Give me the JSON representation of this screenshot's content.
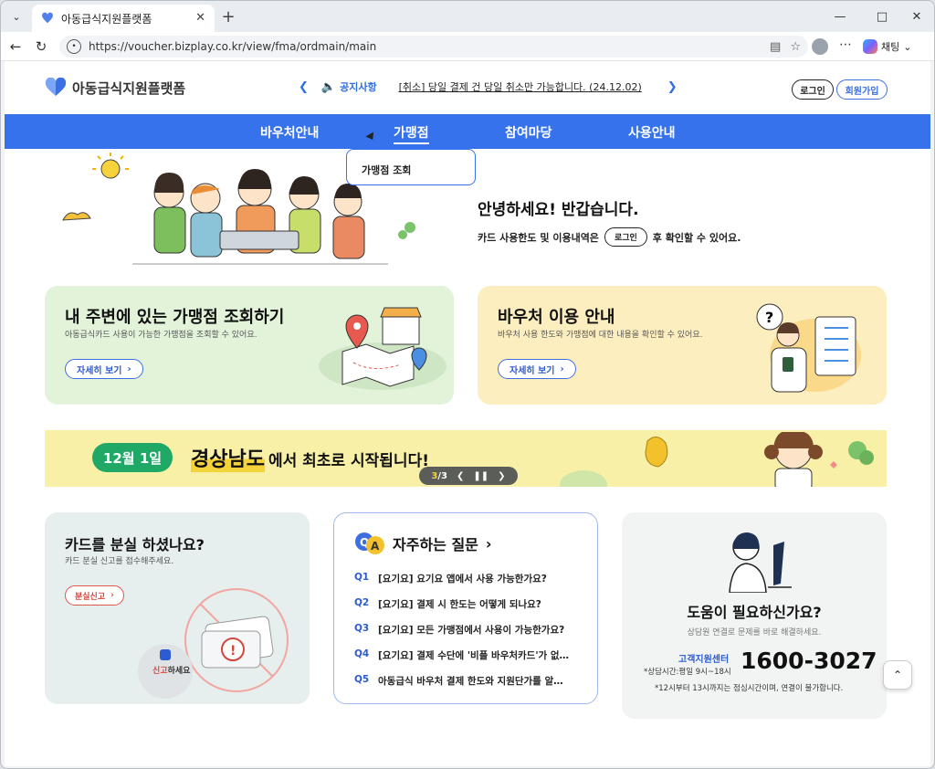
{
  "browser": {
    "tab_title": "아동급식지원플랫폼",
    "url": "https://voucher.bizplay.co.kr/view/fma/ordmain/main",
    "chat_label": "채팅"
  },
  "site": {
    "logo_text": "아동급식지원플랫폼",
    "notice_label": "공지사항",
    "notice_message": "[취소] 당일 결제 건 당일 취소만 가능합니다. (24.12.02)",
    "login_label": "로그인",
    "join_label": "회원가입"
  },
  "gnb": {
    "items": [
      "바우처안내",
      "가맹점",
      "참여마당",
      "사용안내"
    ],
    "active_index": 1,
    "dropdown_item": "가맹점 조회"
  },
  "hero": {
    "greeting": "안녕하세요! 반갑습니다.",
    "sub_before": "카드 사용한도 및 이용내역은",
    "sub_login": "로그인",
    "sub_after": "후 확인할 수 있어요."
  },
  "cards": {
    "nearby": {
      "title": "내 주변에 있는 가맹점 조회하기",
      "desc": "아동급식카드 사용이 가능한 가맹점을 조회할 수 있어요.",
      "button": "자세히 보기"
    },
    "voucher": {
      "title": "바우처 이용 안내",
      "desc": "바우처 사용 한도와 가맹점에 대한 내용을 확인할 수 있어요.",
      "button": "자세히 보기"
    },
    "lost": {
      "title": "카드를 분실 하셨나요?",
      "desc": "카드 분실 신고를 접수해주세요.",
      "button": "분실신고",
      "badge_red": "신고",
      "badge_rest": "하세요"
    },
    "faq": {
      "title": "자주하는 질문",
      "items": [
        {
          "q": "Q1",
          "text": "[요기요] 요기요 앱에서 사용 가능한가요?"
        },
        {
          "q": "Q2",
          "text": "[요기요] 결제 시 한도는 어떻게 되나요?"
        },
        {
          "q": "Q3",
          "text": "[요기요] 모든 가맹점에서 사용이 가능한가요?"
        },
        {
          "q": "Q4",
          "text": "[요기요] 결제 수단에 '비플 바우처카드'가 없…"
        },
        {
          "q": "Q5",
          "text": "아동급식 바우처 결제 한도와 지원단가를 알…"
        }
      ]
    },
    "help": {
      "title": "도움이 필요하신가요?",
      "desc": "상담원 연결로 문제를 바로 해결하세요.",
      "center_label": "고객지원센터",
      "hours": "*상담시간:평일 9시~18시",
      "phone": "1600-3027",
      "note": "*12시부터 13시까지는 점심시간이며, 연결이 불가합니다."
    }
  },
  "banner": {
    "date": "12월 1일",
    "highlight": "경상남도",
    "rest": "에서 최초로 시작됩니다!",
    "page_current": "3",
    "page_total": "/3"
  },
  "colors": {
    "brand_blue": "#3572ec",
    "green_card": "#e2f3da",
    "yellow_card": "#fdeebf",
    "banner_yellow": "#f8f0a6",
    "pill_green": "#1fa866"
  }
}
